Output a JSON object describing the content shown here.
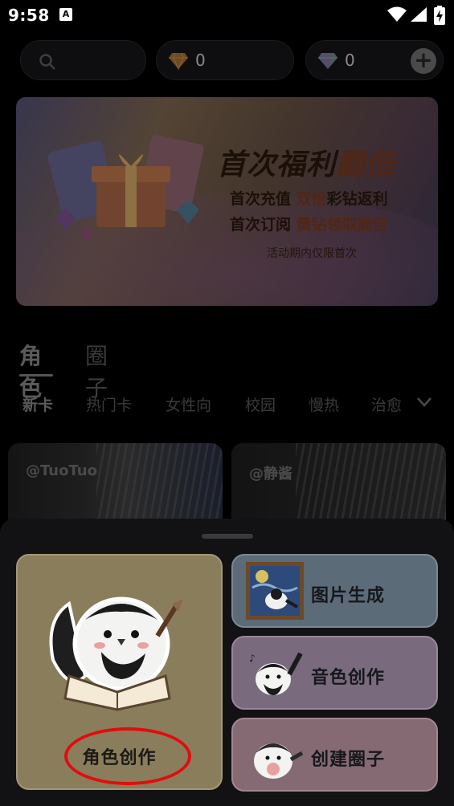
{
  "status_bar": {
    "time": "9:58",
    "notification_icon": "A"
  },
  "top_bar": {
    "search_icon": "search-icon",
    "gem_orange_count": "0",
    "gem_rainbow_count": "0",
    "plus_label": "+"
  },
  "banner": {
    "title_part1": "首次福利",
    "title_part2": "翻倍",
    "line1_a": "首次充值 ",
    "line1_b": "双倍",
    "line1_c": "彩钻返利",
    "line2_a": "首次订阅 ",
    "line2_b": "黄钻领取翻倍",
    "note": "活动期内仅限首次"
  },
  "main_tabs": [
    "角色",
    "圈子"
  ],
  "sub_tabs": [
    "新卡",
    "热门卡",
    "女性向",
    "校园",
    "慢热",
    "治愈"
  ],
  "cards": [
    {
      "author": "@TuoTuo"
    },
    {
      "author": "@静酱"
    }
  ],
  "sheet": {
    "big_option": {
      "label": "角色创作"
    },
    "options": [
      {
        "label": "图片生成"
      },
      {
        "label": "音色创作"
      },
      {
        "label": "创建圈子"
      }
    ]
  },
  "colors": {
    "highlight_ellipse": "#e10d0d",
    "card_gold": "#8a7d5c",
    "card_blue": "#5c6b78",
    "card_purple": "#7a6a7d",
    "card_rose": "#856a73"
  }
}
